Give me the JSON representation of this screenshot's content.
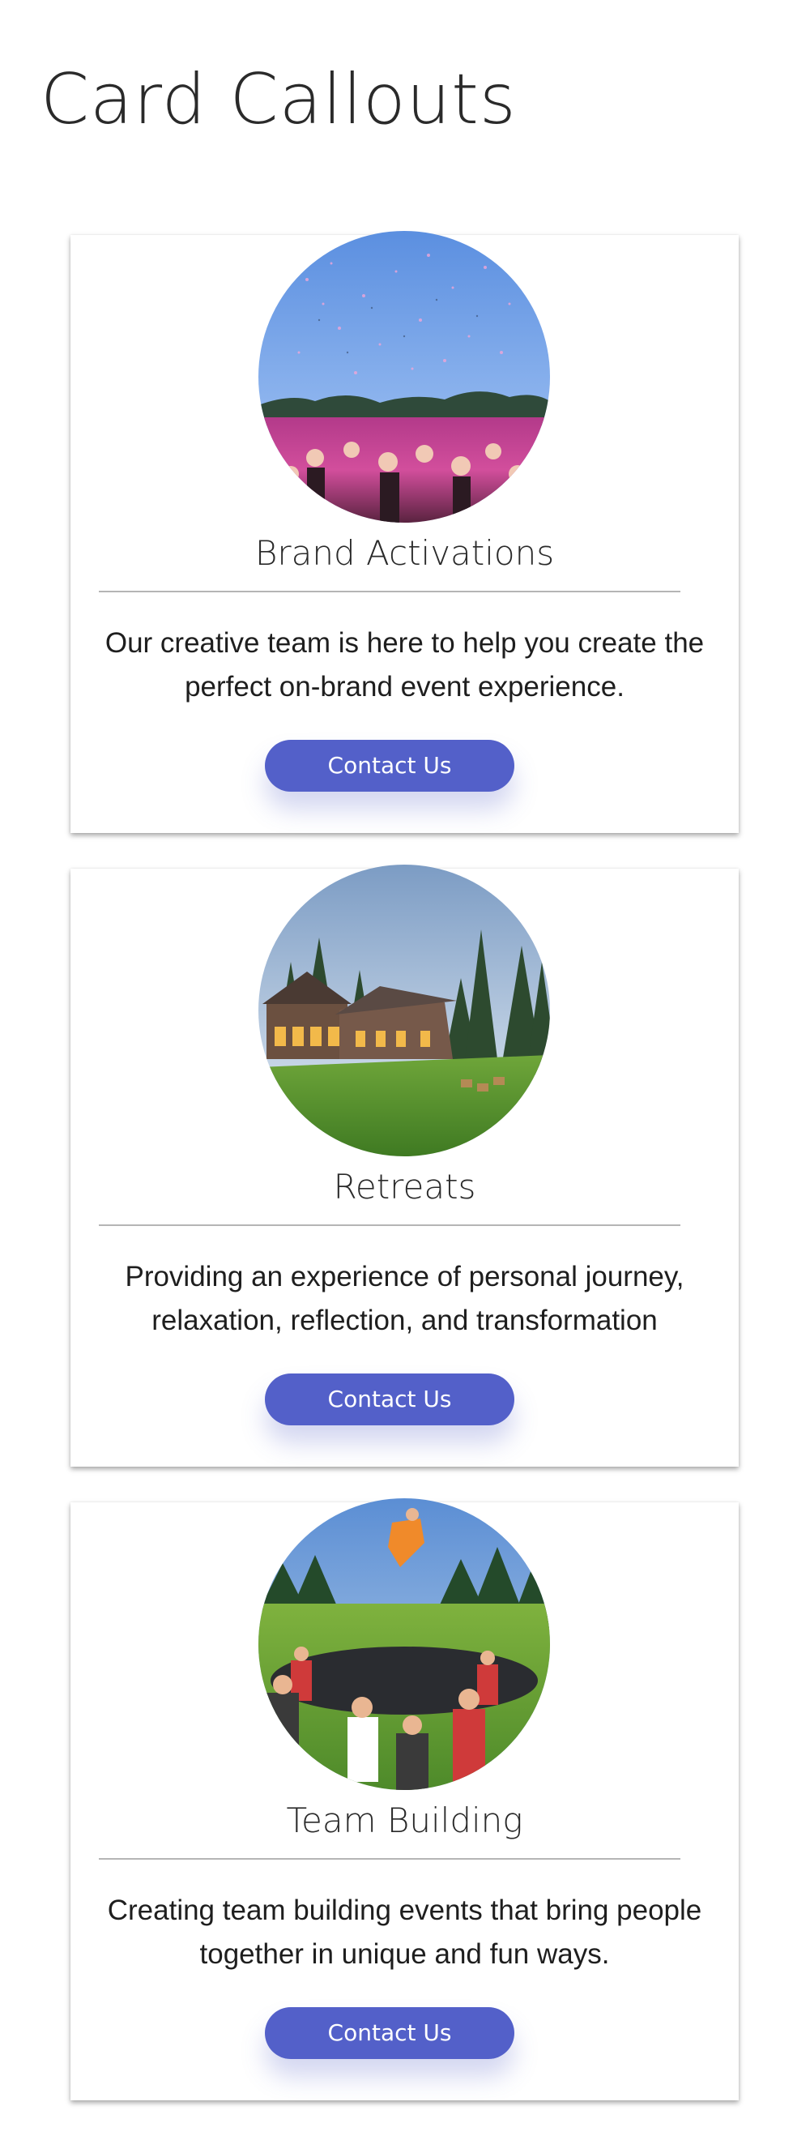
{
  "page": {
    "title": "Card Callouts"
  },
  "cards": [
    {
      "image": "concert-crowd-confetti-photo",
      "title": "Brand Activations",
      "text": "Our creative team is here to help you create the perfect on-brand event experience.",
      "button_label": "Contact Us"
    },
    {
      "image": "lodge-forest-retreat-photo",
      "title": "Retreats",
      "text": "Providing an experience of personal journey, relaxation, reflection, and transformation",
      "button_label": "Contact Us"
    },
    {
      "image": "team-trampoline-toss-photo",
      "title": "Team Building",
      "text": "Creating team building events that bring people together in unique and fun ways.",
      "button_label": "Contact Us"
    }
  ],
  "colors": {
    "button": "#5360c9",
    "button_text": "#ffffff",
    "divider": "#b5b5b5",
    "title_text": "#2a2a2a"
  }
}
